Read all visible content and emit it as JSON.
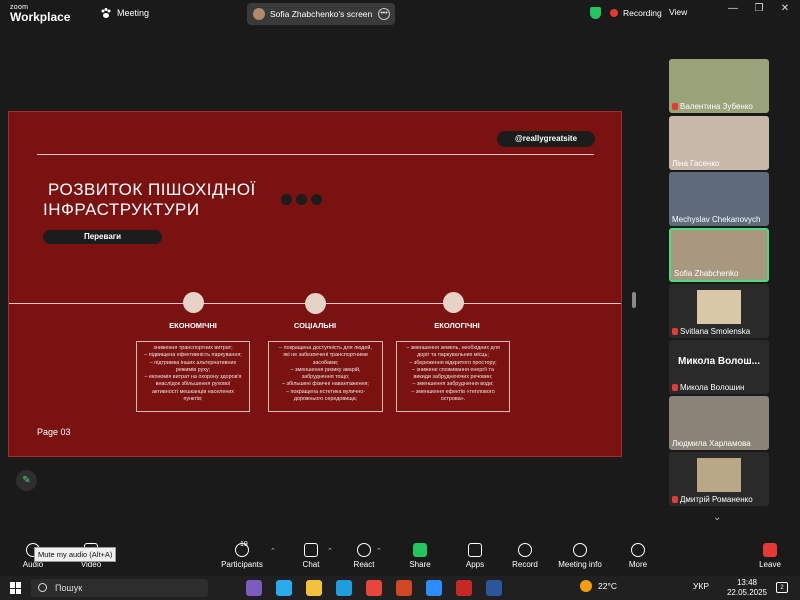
{
  "app": {
    "logo_top": "zoom",
    "logo_bottom": "Workplace",
    "meeting_label": "Meeting",
    "screen_share_label": "Sofia Zhabchenko's screen",
    "recording_label": "Recording",
    "view_label": "View",
    "window_controls": [
      "—",
      "❐",
      "✕"
    ]
  },
  "slide": {
    "site_handle": "@reallygreatsite",
    "title_line1": "РОЗВИТОК ПІШОХІДНОЇ",
    "title_line2": "ІНФРАСТРУКТУРИ",
    "badge": "Переваги",
    "columns": [
      {
        "title": "ЕКОНОМІЧНІ",
        "lines": [
          "зниження транспортних витрат;",
          "– підвищена ефективність паркування;",
          "– підтримка інших альтернативних",
          "режимів руху;",
          "– економія витрат на охорону здоров'я",
          "внаслідок збільшення рухової",
          "активності мешканців населених",
          "пунктів;"
        ]
      },
      {
        "title": "СОЦІАЛЬНІ",
        "lines": [
          "– покращена доступність для людей,",
          "які не забезпечені транспортними",
          "засобами;",
          "– зменшення ризику аварій,",
          "забруднення тощо;",
          "– збільшені фізичні навантаження;",
          "– покращена естетика вулично-",
          "дорожнього середовища;"
        ]
      },
      {
        "title": "ЕКОЛОГІЧНІ",
        "lines": [
          "– зменшення земель, необхідних для",
          "доріг та паркувальних місць;",
          "– збереження відкритого простору;",
          "– знижене споживання енергії та",
          "викиди забруднюючих речовин;",
          "– зменшення забруднення води;",
          "– зменшення ефектів «теплового",
          "острова»."
        ]
      }
    ],
    "page_label": "Page 03"
  },
  "participants": [
    {
      "name": "Валентина Зубенко",
      "muted": true,
      "bg": "#9aa27a"
    },
    {
      "name": "Ліна Гасенко",
      "muted": false,
      "bg": "#c8b8aa"
    },
    {
      "name": "Mechyslav Chekanovych",
      "muted": false,
      "bg": "#5d6b7a"
    },
    {
      "name": "Sofia Zhabchenko",
      "muted": false,
      "bg": "#a89880",
      "active": true
    },
    {
      "name": "Svitlana Smolenska",
      "muted": true,
      "bg": "#2a2a2a"
    },
    {
      "name": "Микола Волошин",
      "muted": true,
      "bg": "#2a2a2a",
      "display": "Микола Волош..."
    },
    {
      "name": "Людмила Харламова",
      "muted": false,
      "bg": "#8a8478"
    },
    {
      "name": "Дмитрій Романенко",
      "muted": true,
      "bg": "#2a2a2a"
    }
  ],
  "toolbar": {
    "audio": "Audio",
    "video": "Video",
    "participants": "Participants",
    "participants_count": "19",
    "chat": "Chat",
    "react": "React",
    "share": "Share",
    "apps": "Apps",
    "record": "Record",
    "meeting_info": "Meeting info",
    "more": "More",
    "leave": "Leave",
    "tooltip": "Mute my audio (Alt+A)"
  },
  "taskbar": {
    "search": "Пошук",
    "temperature": "22°C",
    "language": "УКР",
    "time": "13:48",
    "date": "22.05.2025",
    "notifications": "2"
  }
}
